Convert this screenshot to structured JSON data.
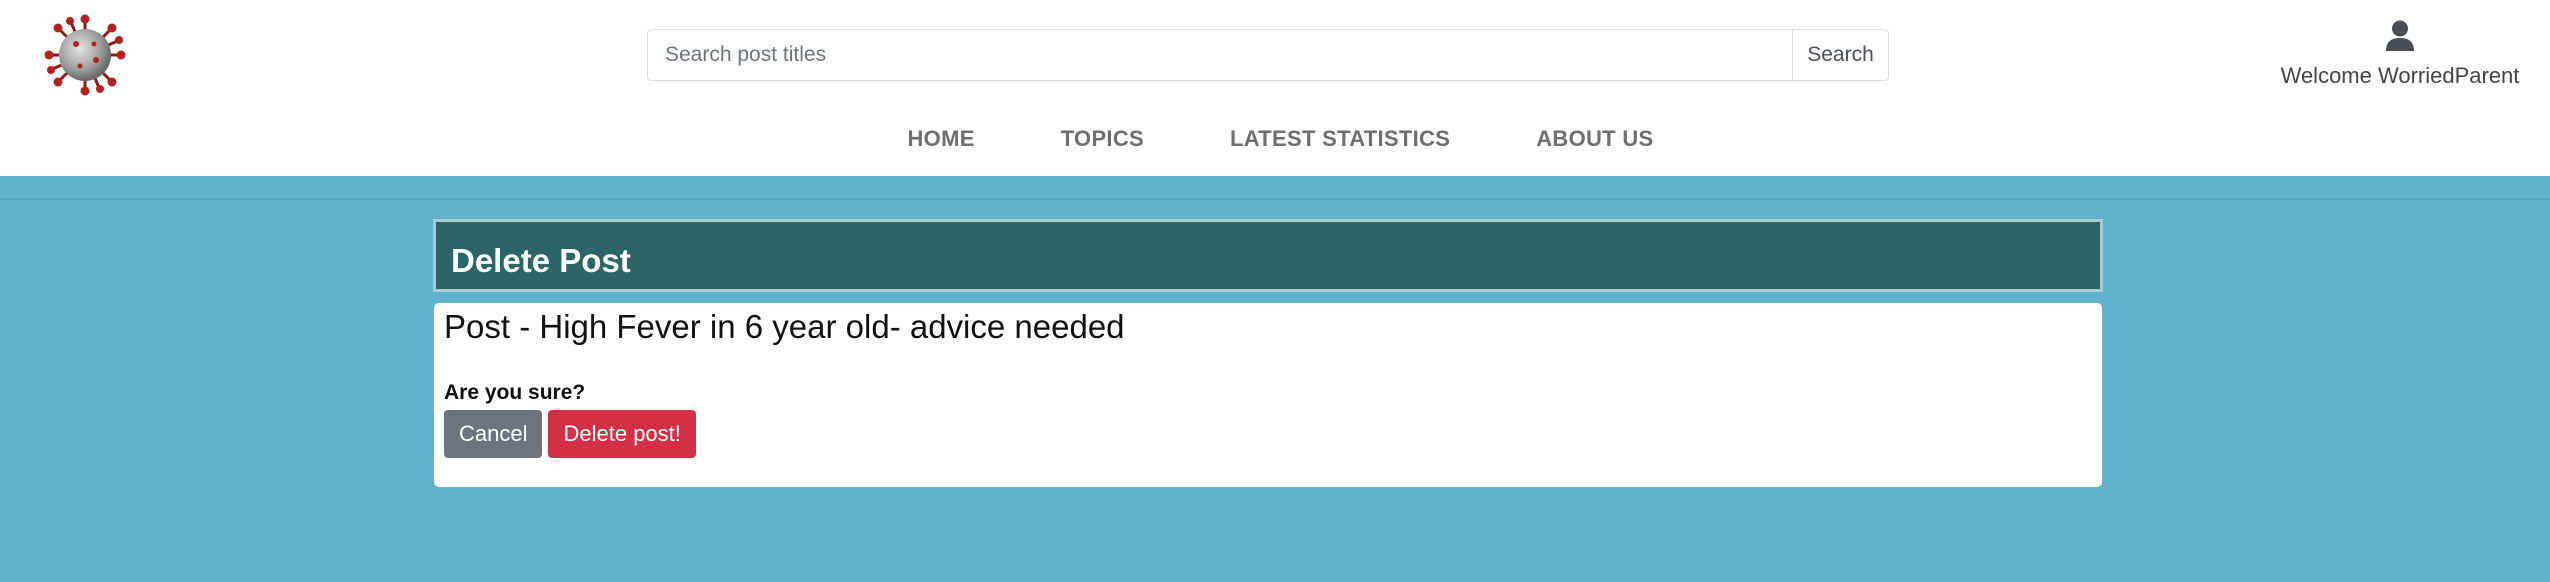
{
  "header": {
    "logo_alt": "virus logo",
    "search": {
      "placeholder": "Search post titles",
      "value": "",
      "button_label": "Search"
    },
    "user": {
      "icon": "user-icon",
      "welcome": "Welcome WorriedParent"
    }
  },
  "nav": {
    "items": [
      {
        "label": "HOME"
      },
      {
        "label": "TOPICS"
      },
      {
        "label": "LATEST STATISTICS"
      },
      {
        "label": "ABOUT US"
      }
    ]
  },
  "main": {
    "header_title": "Delete Post",
    "post_title": "Post - High Fever in 6 year old- advice needed",
    "confirm_text": "Are you sure?",
    "cancel_label": "Cancel",
    "delete_label": "Delete post!"
  },
  "colors": {
    "page_bg": "#61b2cf",
    "header_bar": "#2c6567",
    "cancel": "#6c757d",
    "delete": "#d42f45"
  }
}
